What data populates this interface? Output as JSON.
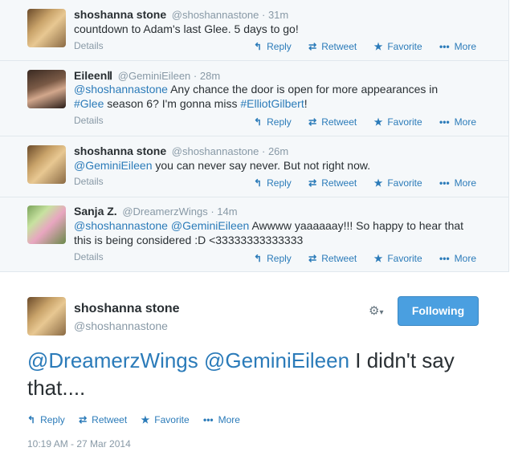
{
  "conversation": [
    {
      "name": "shoshanna stone",
      "screen_name": "@shoshannastone",
      "time": "31m",
      "text": [
        {
          "t": "countdown to Adam's last Glee. 5 days to go!",
          "link": false
        }
      ],
      "details": "Details"
    },
    {
      "name": "EileenⅡ",
      "screen_name": "@GeminiEileen",
      "time": "28m",
      "text": [
        {
          "t": "@shoshannastone",
          "link": true
        },
        {
          "t": " Any chance the door is open for more appearances in ",
          "link": false
        },
        {
          "t": "#Glee",
          "link": true
        },
        {
          "t": " season 6? I'm gonna miss ",
          "link": false
        },
        {
          "t": "#ElliotGilbert",
          "link": true
        },
        {
          "t": "!",
          "link": false
        }
      ],
      "details": "Details"
    },
    {
      "name": "shoshanna stone",
      "screen_name": "@shoshannastone",
      "time": "26m",
      "text": [
        {
          "t": "@GeminiEileen",
          "link": true
        },
        {
          "t": " you can never say never. But not right now.",
          "link": false
        }
      ],
      "details": "Details"
    },
    {
      "name": "Sanja Z.",
      "screen_name": "@DreamerzWings",
      "time": "14m",
      "text": [
        {
          "t": "@shoshannastone",
          "link": true
        },
        {
          "t": " ",
          "link": false
        },
        {
          "t": "@GeminiEileen",
          "link": true
        },
        {
          "t": " Awwww yaaaaaay!!! So happy to hear that this is being considered :D <33333333333333",
          "link": false
        }
      ],
      "details": "Details"
    }
  ],
  "actions": {
    "reply": "Reply",
    "retweet": "Retweet",
    "favorite": "Favorite",
    "more": "More"
  },
  "main_tweet": {
    "name": "shoshanna stone",
    "screen_name": "@shoshannastone",
    "follow_button": "Following",
    "text_mention_1": "@DreamerzWings",
    "text_mention_2": "@GeminiEileen",
    "text_rest": " I didn't say that....",
    "timestamp": "10:19 AM - 27 Mar 2014"
  },
  "colors": {
    "link": "#2b7bb9",
    "follow_button": "#4a9fe0",
    "muted": "#8899a6"
  },
  "icons": {
    "reply": "reply-arrow-icon",
    "retweet": "retweet-icon",
    "favorite": "star-icon",
    "more": "ellipsis-icon",
    "settings": "gear-icon"
  }
}
